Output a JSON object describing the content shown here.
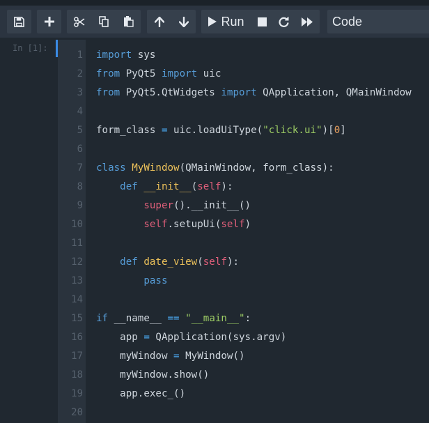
{
  "toolbar": {
    "icons": [
      "save-icon",
      "plus-icon",
      "scissors-icon",
      "copy-icon",
      "paste-icon",
      "arrow-up-icon",
      "arrow-down-icon",
      "play-icon",
      "stop-icon",
      "restart-icon",
      "fast-forward-icon"
    ],
    "run_label": "Run",
    "cell_type": "Code"
  },
  "cell": {
    "prompt": "In [1]:",
    "line_numbers": [
      "1",
      "2",
      "3",
      "4",
      "5",
      "6",
      "7",
      "8",
      "9",
      "10",
      "11",
      "12",
      "13",
      "14",
      "15",
      "16",
      "17",
      "18",
      "19",
      "20"
    ],
    "lines": [
      "import sys",
      "from PyQt5 import uic",
      "from PyQt5.QtWidgets import QApplication, QMainWindow",
      "",
      "form_class = uic.loadUiType(\"click.ui\")[0]",
      "",
      "class MyWindow(QMainWindow, form_class):",
      "    def __init__(self):",
      "        super().__init__()",
      "        self.setupUi(self)",
      "",
      "    def date_view(self):",
      "        pass",
      "",
      "if __name__ == \"__main__\":",
      "    app = QApplication(sys.argv)",
      "    myWindow = MyWindow()",
      "    myWindow.show()",
      "    app.exec_()",
      ""
    ]
  },
  "colors": {
    "background": "#202830",
    "toolbar": "#2b3440",
    "keyword": "#569cd6",
    "string": "#9ccc64",
    "function": "#ecc15a",
    "self": "#e05f7a",
    "accent": "#3b8be4"
  }
}
